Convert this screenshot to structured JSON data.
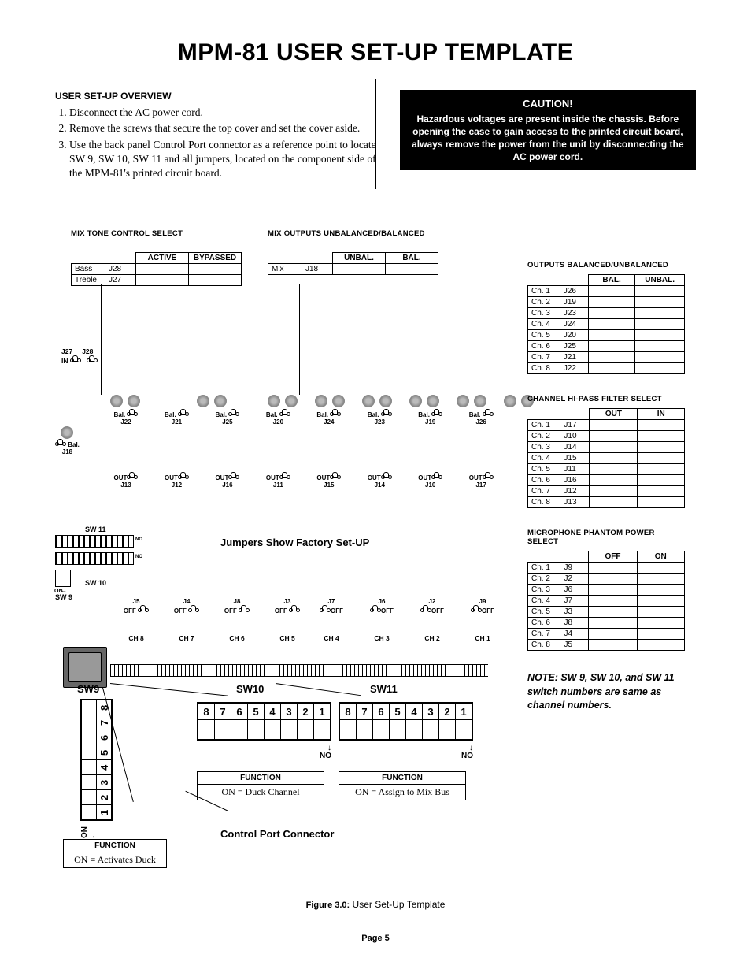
{
  "title": "MPM-81 USER SET-UP TEMPLATE",
  "overview": {
    "heading": "USER SET-UP OVERVIEW",
    "steps": [
      "Disconnect the AC power cord.",
      "Remove the screws that secure the top cover and set the cover aside.",
      "Use the back panel Control Port connector as a reference point to locate SW 9, SW 10, SW 11 and all jumpers, located on the component side of the MPM-81's printed circuit board."
    ]
  },
  "caution": {
    "title": "CAUTION!",
    "body": "Hazardous voltages are present inside the chassis. Before opening the case to gain access to the printed circuit board, always remove the power from the unit by disconnecting the AC power cord."
  },
  "mix_tone": {
    "heading": "MIX TONE CONTROL SELECT",
    "col_active": "ACTIVE",
    "col_bypassed": "BYPASSED",
    "rows": [
      {
        "name": "Bass",
        "j": "J28"
      },
      {
        "name": "Treble",
        "j": "J27"
      }
    ],
    "in_label": "IN",
    "in_j1": "J27",
    "in_j2": "J28"
  },
  "mix_out": {
    "heading": "MIX OUTPUTS UNBALANCED/BALANCED",
    "col_unbal": "UNBAL.",
    "col_bal": "BAL.",
    "row": {
      "name": "Mix",
      "j": "J18"
    }
  },
  "outputs_balun": {
    "heading": "OUTPUTS BALANCED/UNBALANCED",
    "col_bal": "BAL.",
    "col_unbal": "UNBAL.",
    "rows": [
      {
        "ch": "Ch. 1",
        "j": "J26"
      },
      {
        "ch": "Ch. 2",
        "j": "J19"
      },
      {
        "ch": "Ch. 3",
        "j": "J23"
      },
      {
        "ch": "Ch. 4",
        "j": "J24"
      },
      {
        "ch": "Ch. 5",
        "j": "J20"
      },
      {
        "ch": "Ch. 6",
        "j": "J25"
      },
      {
        "ch": "Ch. 7",
        "j": "J21"
      },
      {
        "ch": "Ch. 8",
        "j": "J22"
      }
    ]
  },
  "hipass": {
    "heading": "CHANNEL HI-PASS FILTER SELECT",
    "col_out": "OUT",
    "col_in": "IN",
    "rows": [
      {
        "ch": "Ch. 1",
        "j": "J17"
      },
      {
        "ch": "Ch. 2",
        "j": "J10"
      },
      {
        "ch": "Ch. 3",
        "j": "J14"
      },
      {
        "ch": "Ch. 4",
        "j": "J15"
      },
      {
        "ch": "Ch. 5",
        "j": "J11"
      },
      {
        "ch": "Ch. 6",
        "j": "J16"
      },
      {
        "ch": "Ch. 7",
        "j": "J12"
      },
      {
        "ch": "Ch. 8",
        "j": "J13"
      }
    ]
  },
  "phantom": {
    "heading": "MICROPHONE PHANTOM POWER SELECT",
    "col_off": "OFF",
    "col_on": "ON",
    "rows": [
      {
        "ch": "Ch. 1",
        "j": "J9"
      },
      {
        "ch": "Ch. 2",
        "j": "J2"
      },
      {
        "ch": "Ch. 3",
        "j": "J6"
      },
      {
        "ch": "Ch. 4",
        "j": "J7"
      },
      {
        "ch": "Ch. 5",
        "j": "J3"
      },
      {
        "ch": "Ch. 6",
        "j": "J8"
      },
      {
        "ch": "Ch. 7",
        "j": "J4"
      },
      {
        "ch": "Ch. 8",
        "j": "J5"
      }
    ]
  },
  "bal_row_label": "Bal.",
  "bal_items": [
    {
      "j": "J22"
    },
    {
      "j": "J21"
    },
    {
      "j": "J25"
    },
    {
      "j": "J20"
    },
    {
      "j": "J24"
    },
    {
      "j": "J23"
    },
    {
      "j": "J19"
    },
    {
      "j": "J26"
    }
  ],
  "out_row_label": "OUT",
  "out_items": [
    {
      "j": "J13"
    },
    {
      "j": "J12"
    },
    {
      "j": "J16"
    },
    {
      "j": "J11"
    },
    {
      "j": "J15"
    },
    {
      "j": "J14"
    },
    {
      "j": "J10"
    },
    {
      "j": "J17"
    }
  ],
  "mix_bal": {
    "label": "Bal.",
    "j": "J18"
  },
  "jumpers_title": "Jumpers Show Factory Set-UP",
  "off_row": {
    "left": [
      {
        "j": "J5",
        "ch": "CH 8"
      },
      {
        "j": "J4",
        "ch": "CH 7"
      },
      {
        "j": "J8",
        "ch": "CH 6"
      },
      {
        "j": "J3",
        "ch": "CH 5"
      }
    ],
    "right": [
      {
        "j": "J7",
        "ch": "CH 4"
      },
      {
        "j": "J6",
        "ch": "CH 3"
      },
      {
        "j": "J2",
        "ch": "CH 2"
      },
      {
        "j": "J9",
        "ch": "CH 1"
      }
    ],
    "off": "OFF"
  },
  "sw_labels": {
    "sw9": "SW 9",
    "sw10": "SW 10",
    "sw11": "SW 11"
  },
  "sw_big": {
    "sw9": "SW9",
    "sw10": "SW10",
    "sw11": "SW11"
  },
  "dip_numbers": [
    "8",
    "7",
    "6",
    "5",
    "4",
    "3",
    "2",
    "1"
  ],
  "dip_v_numbers": [
    "8",
    "7",
    "6",
    "5",
    "4",
    "3",
    "2",
    "1"
  ],
  "on_label": "ON",
  "no_label": "NO",
  "arrow": "↓",
  "larrow": "←",
  "sw9_func": {
    "h": "FUNCTION",
    "b": "ON = Activates Duck"
  },
  "sw10_func": {
    "h": "FUNCTION",
    "b": "ON = Duck Channel"
  },
  "sw11_func": {
    "h": "FUNCTION",
    "b": "ON = Assign to Mix Bus"
  },
  "control_port": "Control Port Connector",
  "note": "NOTE: SW 9, SW 10, and SW 11 switch numbers are same as channel numbers.",
  "figure": {
    "num": "Figure 3.0:",
    "text": " User Set-Up Template"
  },
  "page": "Page 5"
}
